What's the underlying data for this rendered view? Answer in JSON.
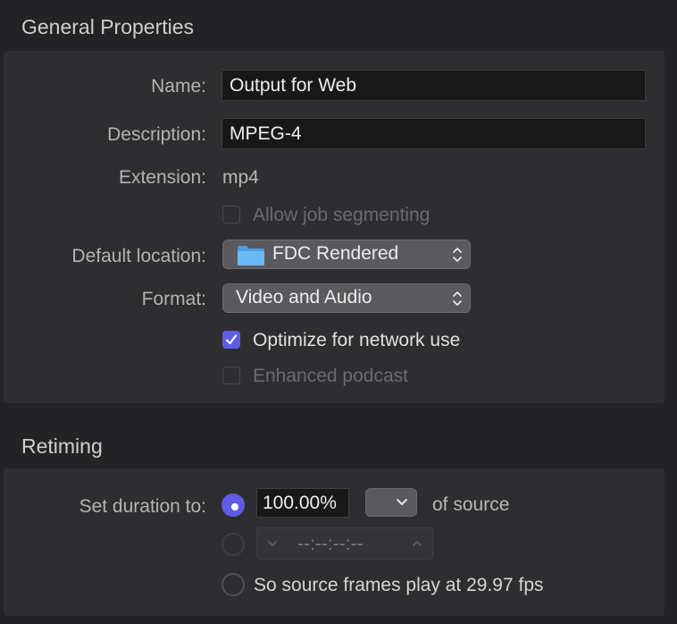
{
  "general": {
    "title": "General Properties",
    "name_label": "Name:",
    "name_value": "Output for Web",
    "description_label": "Description:",
    "description_value": "MPEG-4",
    "extension_label": "Extension:",
    "extension_value": "mp4",
    "segmenting_label": "Allow job segmenting",
    "segmenting_checked": false,
    "location_label": "Default location:",
    "location_value": "FDC Rendered",
    "format_label": "Format:",
    "format_value": "Video and Audio",
    "optimize_label": "Optimize for network use",
    "optimize_checked": true,
    "podcast_label": "Enhanced podcast",
    "podcast_checked": false
  },
  "retiming": {
    "title": "Retiming",
    "duration_label": "Set duration to:",
    "percent_value": "100.00%",
    "of_source_label": "of source",
    "timecode_value": "--:--:--:--",
    "fps_option_label": "So source frames play at 29.97 fps",
    "selected_option": "percent"
  },
  "colors": {
    "accent": "#5e5ce6",
    "folder": "#5ab0f0"
  }
}
